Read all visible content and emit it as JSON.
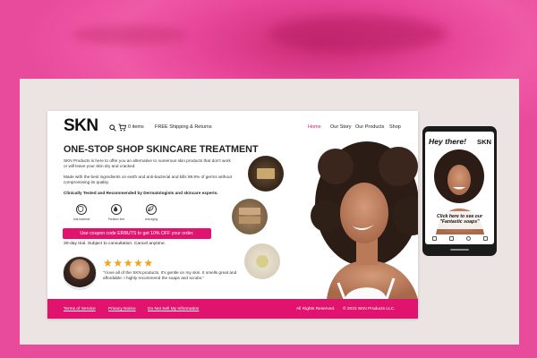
{
  "brand": {
    "logo": "SKN",
    "accent": "#e0146f",
    "background": "#e94b9c"
  },
  "header": {
    "cart_label": "0 items",
    "shipping": "FREE Shipping & Returns",
    "nav": [
      {
        "label": "Home",
        "active": true
      },
      {
        "label": "Our Story",
        "active": false
      },
      {
        "label": "Our Products",
        "active": false
      },
      {
        "label": "Shop",
        "active": false
      }
    ]
  },
  "hero": {
    "headline": "ONE-STOP SHOP SKINCARE TREATMENT",
    "intro": "SKN Products is here to offer you an alternative to numerous skin products that don't work or will leave your skin dry and cracked.",
    "ingredients": "Made with the best ingredients on earth and anti-bacterial and kills 99.9% of germs without compromising its quality.",
    "clinical": "Clinically Tested and Recommended by Dermatologists and skincare experts.",
    "badges": [
      {
        "label": "Anti-bacterial",
        "icon": "shield-icon"
      },
      {
        "label": "Paraben free",
        "icon": "droplet-icon"
      },
      {
        "label": "Anti-aging",
        "icon": "leaf-icon"
      }
    ],
    "coupon": "Use coupon code ERBUTS to get 10% OFF your order.",
    "trial": "30-day trial. Subject to consultation. Cancel anytime."
  },
  "testimonial": {
    "rating": "★★★★★",
    "quote": "\"I love all of the SKN products. It's gentle on my skin. It smells great and affordable. I highly recommend the soaps and scrubs.\""
  },
  "footer": {
    "links": [
      "Terms of Service",
      "Privacy Notice",
      "Do Not Sell My Information"
    ],
    "rights": "All Rights Reserved.",
    "copyright": "© 2023 SKN Products LLC."
  },
  "mobile": {
    "greeting": "Hey there!",
    "logo": "SKN",
    "cta_line1": "Click here to see our",
    "cta_line2": "\"Fantastic soaps\""
  }
}
